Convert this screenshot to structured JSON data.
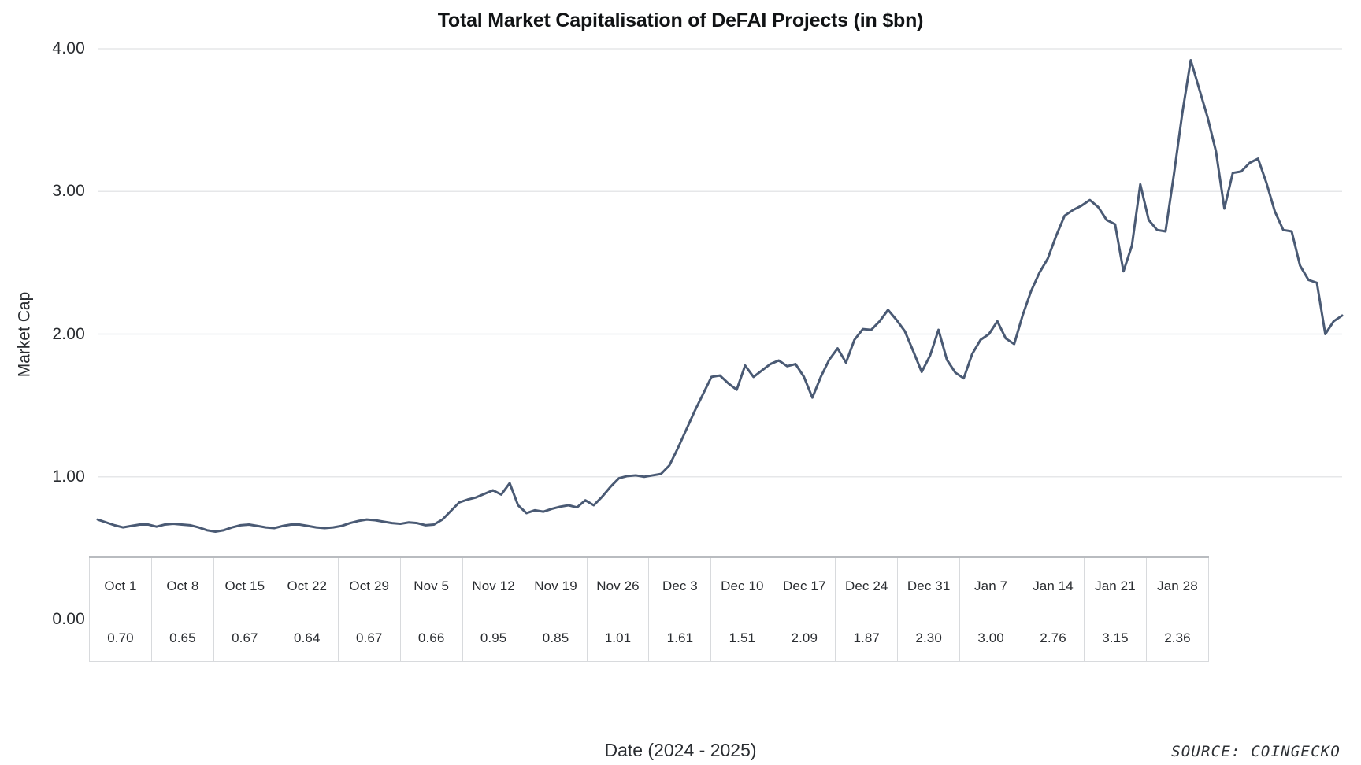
{
  "chart_data": {
    "type": "line",
    "title": "Total Market Capitalisation of DeFAI Projects (in $bn)",
    "xlabel": "Date (2024 - 2025)",
    "ylabel": "Market Cap",
    "ylim": [
      0.0,
      4.0
    ],
    "yticks": [
      "0.00",
      "1.00",
      "2.00",
      "3.00",
      "4.00"
    ],
    "grid": true,
    "legend": null,
    "source": "SOURCE: COINGECKO",
    "line_color": "#4a5a74",
    "categories": [
      "Oct 1",
      "Oct 8",
      "Oct 15",
      "Oct 22",
      "Oct 29",
      "Nov 5",
      "Nov 12",
      "Nov 19",
      "Nov 26",
      "Dec 3",
      "Dec 10",
      "Dec 17",
      "Dec 24",
      "Dec 31",
      "Jan 7",
      "Jan 14",
      "Jan 21",
      "Jan 28"
    ],
    "values": [
      0.7,
      0.65,
      0.67,
      0.64,
      0.67,
      0.66,
      0.95,
      0.85,
      1.01,
      1.61,
      1.51,
      2.09,
      1.87,
      2.3,
      3.0,
      2.76,
      3.15,
      2.36
    ],
    "daily_series": [
      0.7,
      0.68,
      0.66,
      0.645,
      0.655,
      0.665,
      0.665,
      0.65,
      0.665,
      0.67,
      0.665,
      0.66,
      0.645,
      0.625,
      0.615,
      0.625,
      0.645,
      0.66,
      0.665,
      0.655,
      0.645,
      0.64,
      0.655,
      0.665,
      0.665,
      0.655,
      0.645,
      0.64,
      0.645,
      0.655,
      0.675,
      0.69,
      0.7,
      0.695,
      0.685,
      0.675,
      0.67,
      0.68,
      0.675,
      0.66,
      0.665,
      0.7,
      0.76,
      0.82,
      0.84,
      0.855,
      0.88,
      0.905,
      0.875,
      0.955,
      0.8,
      0.745,
      0.765,
      0.755,
      0.775,
      0.79,
      0.8,
      0.785,
      0.835,
      0.8,
      0.86,
      0.93,
      0.99,
      1.005,
      1.01,
      1.0,
      1.01,
      1.02,
      1.08,
      1.2,
      1.33,
      1.46,
      1.58,
      1.7,
      1.71,
      1.655,
      1.61,
      1.78,
      1.7,
      1.745,
      1.79,
      1.815,
      1.775,
      1.79,
      1.7,
      1.555,
      1.7,
      1.82,
      1.9,
      1.8,
      1.96,
      2.035,
      2.03,
      2.09,
      2.17,
      2.1,
      2.02,
      1.88,
      1.735,
      1.85,
      2.03,
      1.82,
      1.73,
      1.69,
      1.86,
      1.96,
      2.0,
      2.09,
      1.97,
      1.93,
      2.13,
      2.3,
      2.43,
      2.53,
      2.69,
      2.83,
      2.87,
      2.9,
      2.94,
      2.89,
      2.8,
      2.77,
      2.44,
      2.62,
      3.05,
      2.8,
      2.73,
      2.72,
      3.12,
      3.55,
      3.92,
      3.72,
      3.52,
      3.28,
      2.88,
      3.13,
      3.14,
      3.2,
      3.23,
      3.06,
      2.86,
      2.73,
      2.72,
      2.48,
      2.38,
      2.36,
      2.0,
      2.09,
      2.13
    ]
  }
}
